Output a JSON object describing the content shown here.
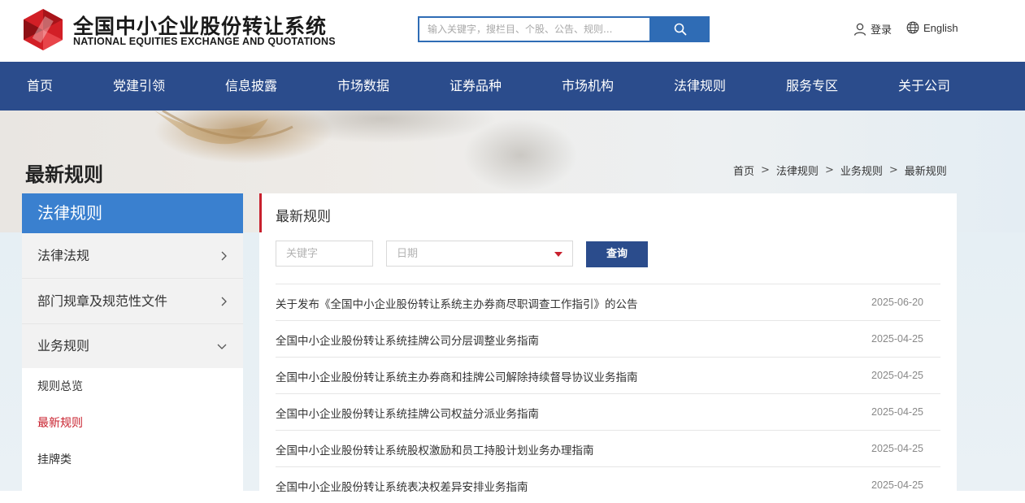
{
  "header": {
    "logo_cn": "全国中小企业股份转让系统",
    "logo_en": "NATIONAL EQUITIES EXCHANGE AND QUOTATIONS",
    "search_placeholder": "输入关键字，搜栏目、个股、公告、规则...",
    "login_label": "登录",
    "lang_label": "English"
  },
  "nav": {
    "items": [
      "首页",
      "党建引领",
      "信息披露",
      "市场数据",
      "证券品种",
      "市场机构",
      "法律规则",
      "服务专区",
      "关于公司"
    ]
  },
  "page": {
    "heading": "最新规则",
    "breadcrumb": [
      "首页",
      "法律规则",
      "业务规则",
      "最新规则"
    ]
  },
  "sidebar": {
    "title": "法律规则",
    "items": [
      {
        "label": "法律法规",
        "icon": "chevron-right-icon"
      },
      {
        "label": "部门规章及规范性文件",
        "icon": "chevron-right-icon"
      },
      {
        "label": "业务规则",
        "icon": "chevron-down-icon"
      }
    ],
    "sub_items": [
      {
        "label": "规则总览",
        "active": false
      },
      {
        "label": "最新规则",
        "active": true
      },
      {
        "label": "挂牌类",
        "active": false
      }
    ]
  },
  "main": {
    "title": "最新规则",
    "keyword_placeholder": "关键字",
    "date_placeholder": "日期",
    "query_label": "查询",
    "rows": [
      {
        "title": "关于发布《全国中小企业股份转让系统主办券商尽职调查工作指引》的公告",
        "date": "2025-06-20"
      },
      {
        "title": "全国中小企业股份转让系统挂牌公司分层调整业务指南",
        "date": "2025-04-25"
      },
      {
        "title": "全国中小企业股份转让系统主办券商和挂牌公司解除持续督导协议业务指南",
        "date": "2025-04-25"
      },
      {
        "title": "全国中小企业股份转让系统挂牌公司权益分派业务指南",
        "date": "2025-04-25"
      },
      {
        "title": "全国中小企业股份转让系统股权激励和员工持股计划业务办理指南",
        "date": "2025-04-25"
      },
      {
        "title": "全国中小企业股份转让系统表决权差异安排业务指南",
        "date": "2025-04-25"
      }
    ]
  },
  "colors": {
    "nav_bg": "#2b4c8c",
    "accent_blue": "#2f6cb5",
    "sidebar_head": "#3a80cf",
    "active_red": "#c8202d"
  }
}
